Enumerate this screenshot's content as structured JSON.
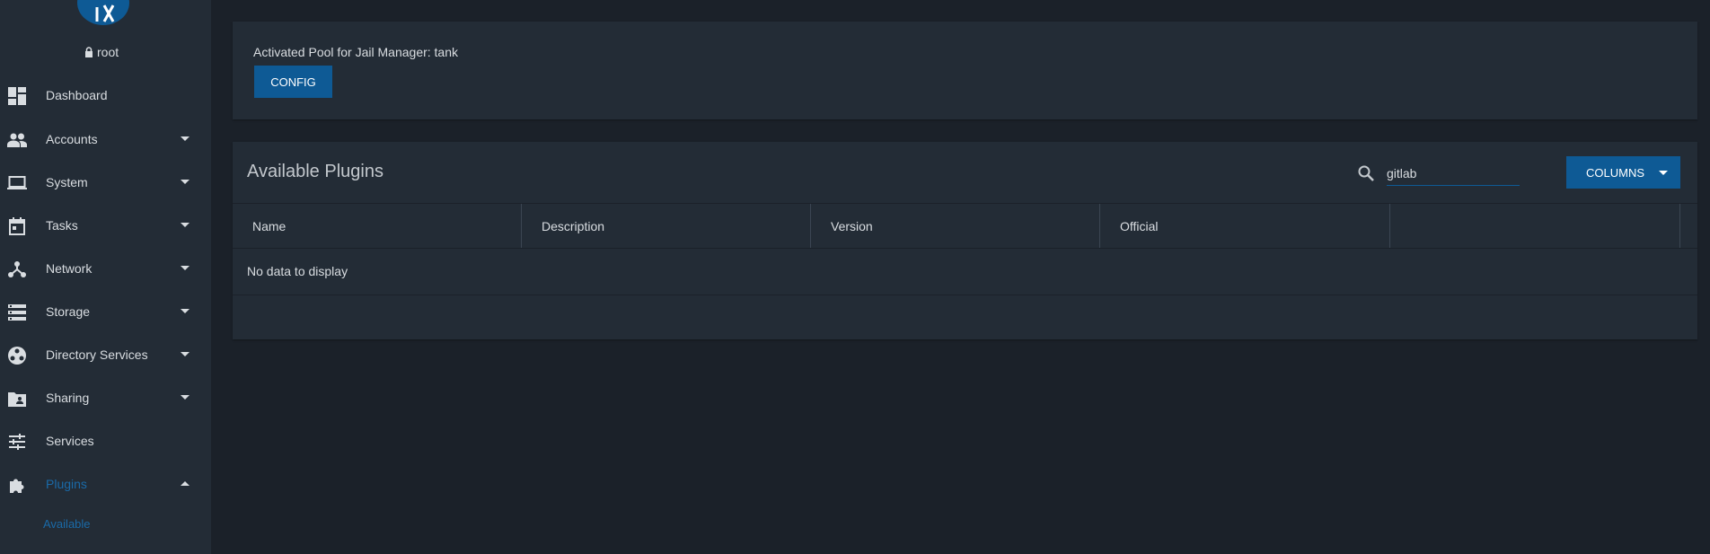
{
  "sidebar": {
    "user": "root",
    "items": [
      {
        "label": "Dashboard",
        "icon": "dashboard-icon",
        "expandable": false
      },
      {
        "label": "Accounts",
        "icon": "people-icon",
        "expandable": true
      },
      {
        "label": "System",
        "icon": "laptop-icon",
        "expandable": true
      },
      {
        "label": "Tasks",
        "icon": "calendar-icon",
        "expandable": true
      },
      {
        "label": "Network",
        "icon": "network-icon",
        "expandable": true
      },
      {
        "label": "Storage",
        "icon": "storage-icon",
        "expandable": true
      },
      {
        "label": "Directory Services",
        "icon": "directory-icon",
        "expandable": true
      },
      {
        "label": "Sharing",
        "icon": "folder-shared-icon",
        "expandable": true
      },
      {
        "label": "Services",
        "icon": "tune-icon",
        "expandable": false
      },
      {
        "label": "Plugins",
        "icon": "puzzle-icon",
        "expandable": true,
        "expanded": true
      }
    ],
    "sub_item": "Available"
  },
  "pool": {
    "text": "Activated Pool for Jail Manager: tank",
    "config_label": "CONFIG"
  },
  "plugins": {
    "title": "Available Plugins",
    "search_value": "gitlab",
    "columns_label": "COLUMNS",
    "headers": [
      "Name",
      "Description",
      "Version",
      "Official",
      ""
    ],
    "empty_text": "No data to display"
  },
  "colors": {
    "background": "#1b2129",
    "panel": "#232c36",
    "accent": "#0e5a95",
    "active_link": "#1a6aa8"
  }
}
